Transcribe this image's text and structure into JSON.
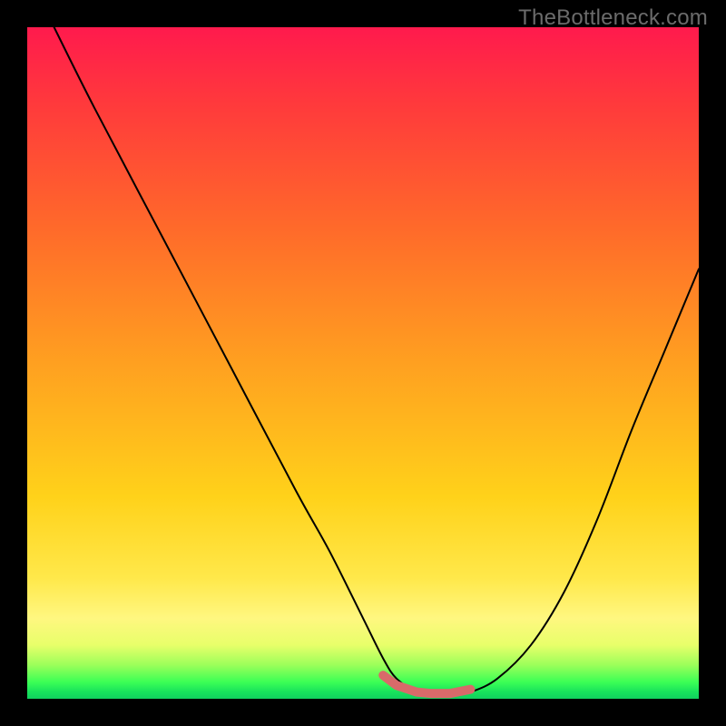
{
  "watermark": "TheBottleneck.com",
  "chart_data": {
    "type": "line",
    "title": "",
    "xlabel": "",
    "ylabel": "",
    "xlim": [
      0,
      100
    ],
    "ylim": [
      0,
      100
    ],
    "grid": false,
    "legend": false,
    "series": [
      {
        "name": "curve",
        "color": "#000000",
        "stroke_width": 2,
        "x": [
          4,
          10,
          20,
          30,
          40,
          45,
          50,
          53,
          55,
          58,
          60,
          63,
          66,
          70,
          75,
          80,
          85,
          90,
          95,
          100
        ],
        "values": [
          100,
          88,
          69,
          50,
          31,
          22,
          12,
          6,
          3,
          1,
          0.5,
          0.5,
          1,
          3,
          8,
          16,
          27,
          40,
          52,
          64
        ]
      },
      {
        "name": "bottom-marker",
        "color": "#d86a6a",
        "is_marker_segment": true,
        "stroke_width": 10,
        "x": [
          53,
          55,
          58,
          60,
          63,
          66
        ],
        "values": [
          3.5,
          2,
          1,
          0.8,
          0.8,
          1.4
        ]
      }
    ]
  }
}
